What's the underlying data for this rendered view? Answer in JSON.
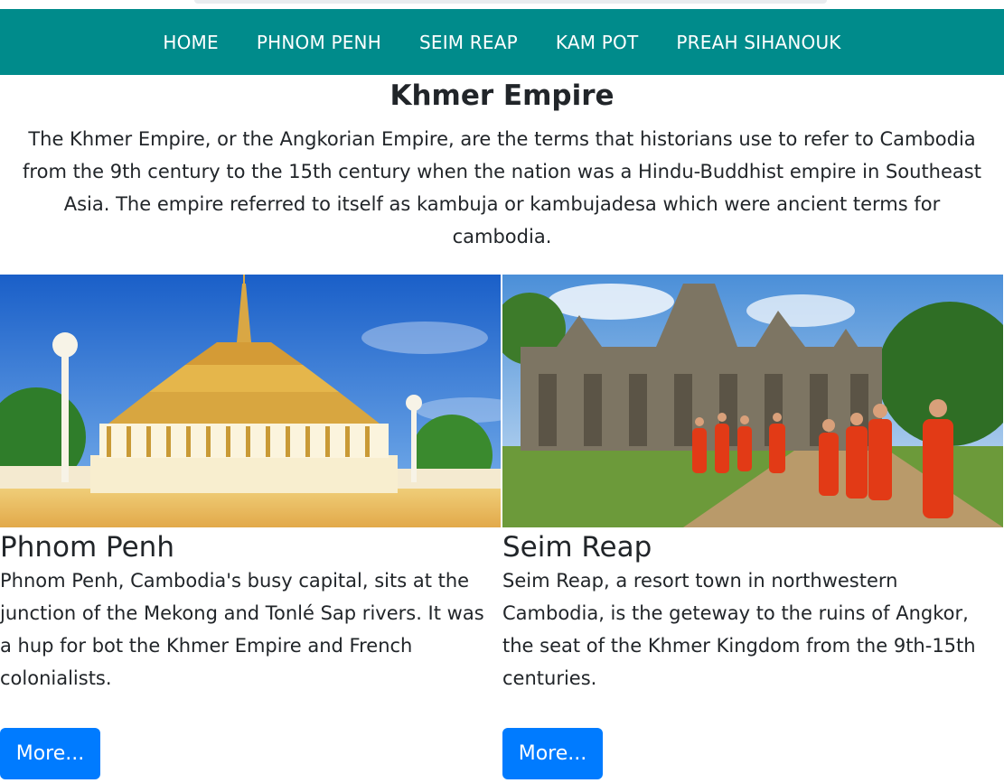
{
  "nav": {
    "items": [
      {
        "label": "HOME"
      },
      {
        "label": "PHNOM PENH"
      },
      {
        "label": "SEIM REAP"
      },
      {
        "label": "KAM POT"
      },
      {
        "label": "PREAH SIHANOUK"
      }
    ]
  },
  "intro": {
    "title": "Khmer Empire",
    "text": "The Khmer Empire, or the Angkorian Empire, are the terms that historians use to refer to Cambodia from the 9th century to the 15th century when the nation was a Hindu-Buddhist empire in Southeast Asia. The empire referred to itself as kambuja or kambujadesa which were ancient terms for cambodia."
  },
  "cards": [
    {
      "title": "Phnom Penh",
      "text": "Phnom Penh, Cambodia's busy capital, sits at the junction of the Mekong and Tonlé Sap rivers. It was a hup for bot the Khmer Empire and French colonialists.",
      "button": "More..."
    },
    {
      "title": "Seim Reap",
      "text": "Seim Reap, a resort town in northwestern Cambodia, is the geteway to the ruins of Angkor, the seat of the Khmer Kingdom from the 9th-15th centuries.",
      "button": "More..."
    }
  ],
  "colors": {
    "navbar": "#008b8b",
    "button": "#007bff"
  }
}
